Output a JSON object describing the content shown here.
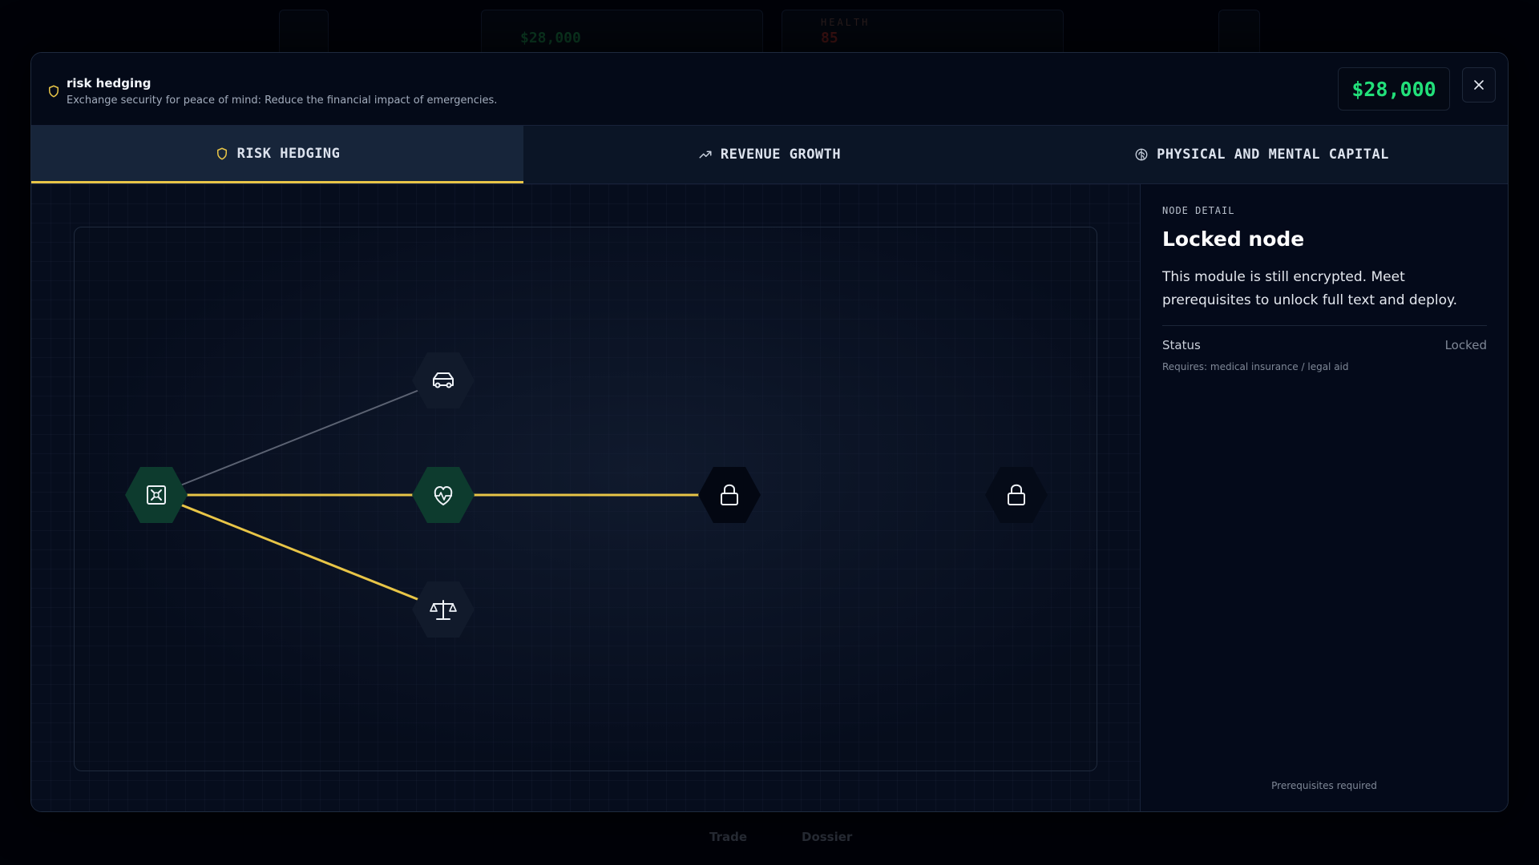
{
  "background": {
    "hud": {
      "money": "$28,000",
      "health_label": "HEALTH",
      "health_value": "85"
    },
    "dock": {
      "trade_label": "Trade",
      "dossier_label": "Dossier"
    }
  },
  "modal": {
    "title": "risk hedging",
    "subtitle": "Exchange security for peace of mind: Reduce the financial impact of emergencies.",
    "money": "$28,000",
    "close_icon": "close-icon",
    "tabs": [
      {
        "label": "RISK HEDGING",
        "icon": "shield-icon",
        "active": true
      },
      {
        "label": "REVENUE GROWTH",
        "icon": "trending-up-icon",
        "active": false
      },
      {
        "label": "PHYSICAL AND MENTAL CAPITAL",
        "icon": "brain-icon",
        "active": false
      }
    ]
  },
  "graph": {
    "nodes": [
      {
        "id": "root",
        "icon": "safe-icon",
        "state": "unlocked"
      },
      {
        "id": "car",
        "icon": "car-icon",
        "state": "available"
      },
      {
        "id": "health",
        "icon": "heart-pulse-icon",
        "state": "unlocked"
      },
      {
        "id": "legal",
        "icon": "scale-icon",
        "state": "available"
      },
      {
        "id": "locked-1",
        "icon": "lock-icon",
        "state": "locked"
      },
      {
        "id": "locked-2",
        "icon": "lock-icon",
        "state": "locked"
      }
    ],
    "edges": [
      {
        "from": "root",
        "to": "car",
        "active": false
      },
      {
        "from": "root",
        "to": "health",
        "active": true
      },
      {
        "from": "root",
        "to": "legal",
        "active": true
      },
      {
        "from": "health",
        "to": "locked-1",
        "active": true
      }
    ]
  },
  "detail": {
    "eyebrow": "NODE DETAIL",
    "title": "Locked node",
    "body": "This module is still encrypted. Meet prerequisites to unlock full text and deploy.",
    "status_label": "Status",
    "status_value": "Locked",
    "requires": "Requires: medical insurance / legal aid",
    "footer": "Prerequisites required"
  },
  "colors": {
    "accent_gold": "#e8c547",
    "money_green": "#22e07a",
    "unlocked_node": "#0d3b2e",
    "available_node": "#111a2b",
    "locked_node": "#030712",
    "inactive_edge": "#5b6272"
  }
}
